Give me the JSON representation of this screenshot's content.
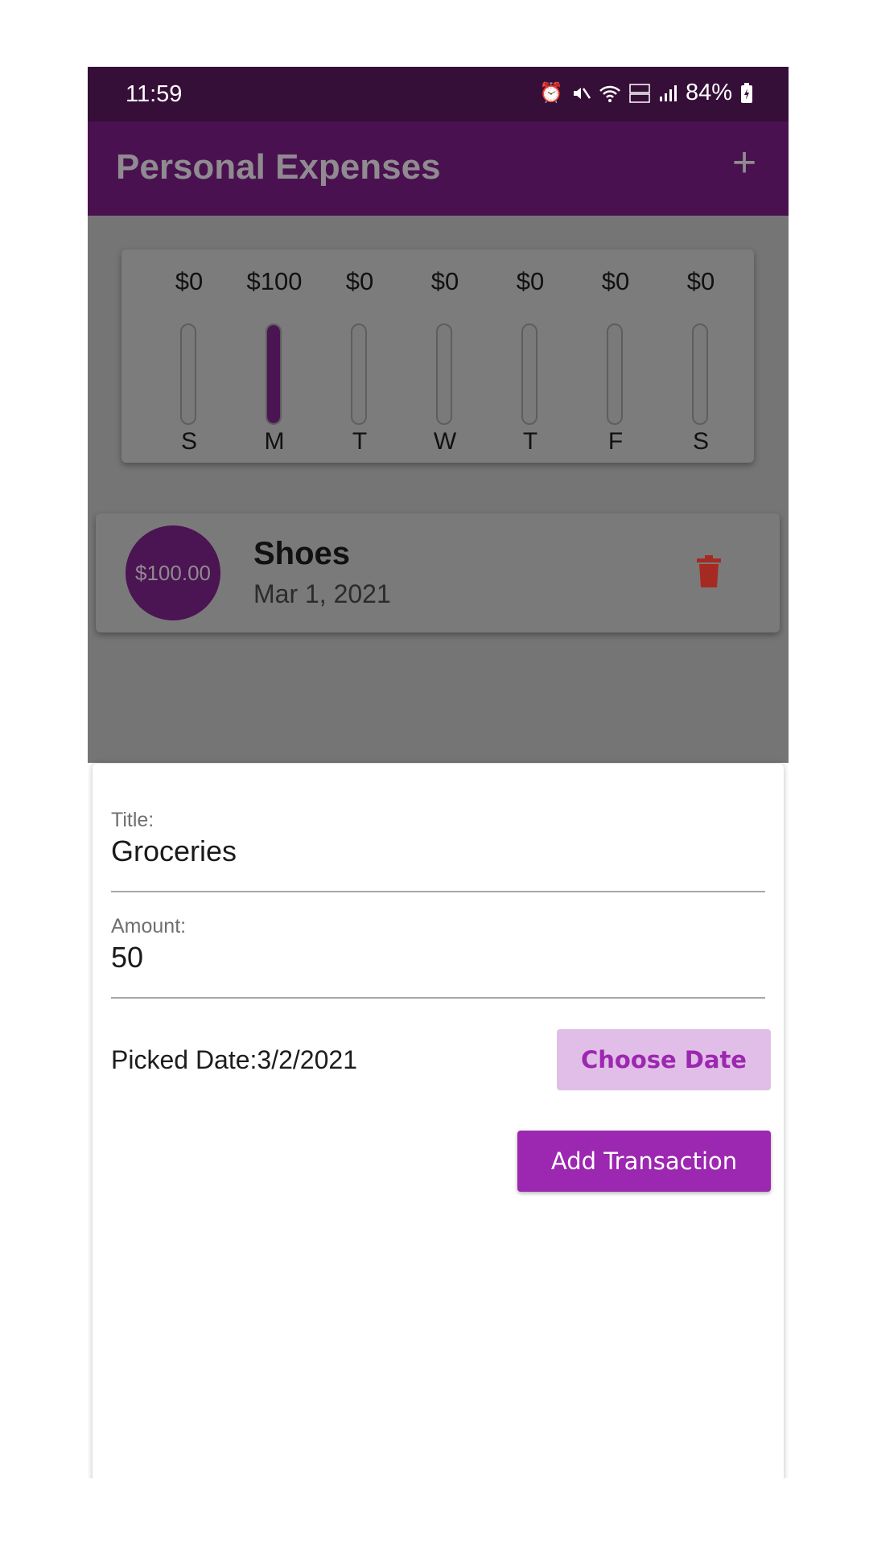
{
  "status_bar": {
    "time": "11:59",
    "battery": "84%",
    "icons": [
      "alarm-icon",
      "mute-icon",
      "wifi-icon",
      "volte-icon",
      "signal-icon",
      "battery-icon"
    ]
  },
  "app_bar": {
    "title": "Personal Expenses",
    "add_icon": "plus-icon"
  },
  "chart_data": {
    "type": "bar",
    "categories": [
      "S",
      "M",
      "T",
      "W",
      "T",
      "F",
      "S"
    ],
    "values": [
      0,
      100,
      0,
      0,
      0,
      0,
      0
    ],
    "value_labels": [
      "$0",
      "$100",
      "$0",
      "$0",
      "$0",
      "$0",
      "$0"
    ],
    "fill_fractions": [
      0,
      1,
      0,
      0,
      0,
      0,
      0
    ]
  },
  "transactions": [
    {
      "amount": "$100.00",
      "title": "Shoes",
      "date": "Mar 1, 2021",
      "delete_icon": "trash-icon"
    }
  ],
  "form": {
    "title_label": "Title:",
    "title_value": "Groceries",
    "amount_label": "Amount:",
    "amount_value": "50",
    "picked_date": "Picked Date:3/2/2021",
    "choose_date_label": "Choose Date",
    "add_transaction_label": "Add Transaction"
  },
  "colors": {
    "primary": "#9c27b0",
    "primary_light": "#e1bee7",
    "app_bar": "#4a1150",
    "delete": "#b3261e"
  }
}
